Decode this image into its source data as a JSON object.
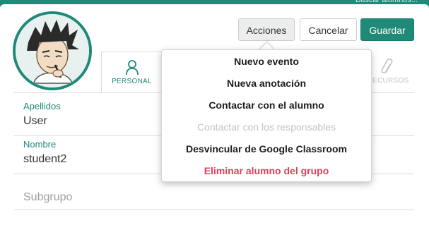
{
  "background": {
    "search_placeholder": "Buscar alumnos..."
  },
  "header": {
    "acciones_label": "Acciones",
    "cancelar_label": "Cancelar",
    "guardar_label": "Guardar"
  },
  "tabs": [
    {
      "label": "PERSONAL",
      "icon": "person-icon",
      "active": true
    },
    {
      "label": "RECURSOS",
      "icon": "paperclip-icon",
      "active": false
    }
  ],
  "form": {
    "apellidos": {
      "label": "Apellidos",
      "value": "User"
    },
    "nombre": {
      "label": "Nombre",
      "value": "student2"
    },
    "subgrupo": {
      "placeholder": "Subgrupo"
    }
  },
  "menu": {
    "items": [
      {
        "label": "Nuevo evento",
        "enabled": true
      },
      {
        "label": "Nueva anotación",
        "enabled": true
      },
      {
        "label": "Contactar con el alumno",
        "enabled": true
      },
      {
        "label": "Contactar con los responsables",
        "enabled": false
      },
      {
        "label": "Desvincular de Google Classroom",
        "enabled": true
      },
      {
        "label": "Eliminar alumno del grupo",
        "enabled": true,
        "danger": true
      }
    ]
  },
  "colors": {
    "accent": "#1f8a78",
    "danger": "#e0405a"
  }
}
